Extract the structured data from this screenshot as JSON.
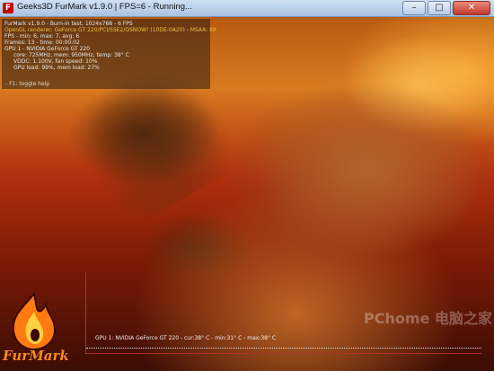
{
  "window": {
    "title": "Geeks3D FurMark v1.9.0 | FPS=6 - Running...",
    "buttons": {
      "minimize": "–",
      "maximize": "□",
      "close": "✕"
    }
  },
  "hud": {
    "line1": "FurMark v1.9.0 - Burn-in test, 1024x768 - 6 FPS",
    "line2": "OpenGL renderer: GeForce GT 220/PCI/SSE2/OSNOW! (10DE-0A20) - MSAA: 8X",
    "line3": "FPS - min: 6, max: 7, avg: 6",
    "line4": "Frames: 13 - time: 00:00:02",
    "gpu_title": "GPU 1 - NVIDIA GeForce GT 220",
    "gpu_core": "core: 725MHz, mem: 950MHz, temp: 38° C",
    "gpu_vddc": "VDDC: 1.100V, fan speed: 10%",
    "gpu_load": "GPU load: 99%, mem load: 27%",
    "help": "- F1: toggle help"
  },
  "graph": {
    "label": "GPU 1: NVIDIA GeForce GT 220 - cur:38° C - min:31° C - max:38° C",
    "line_color": "#e0e0e0",
    "axis_color": "#b03030"
  },
  "logo": {
    "text": "FurMark"
  },
  "watermark": {
    "text": "PChome 电脑之家"
  },
  "icons": {
    "app": "furmark-app-icon"
  }
}
